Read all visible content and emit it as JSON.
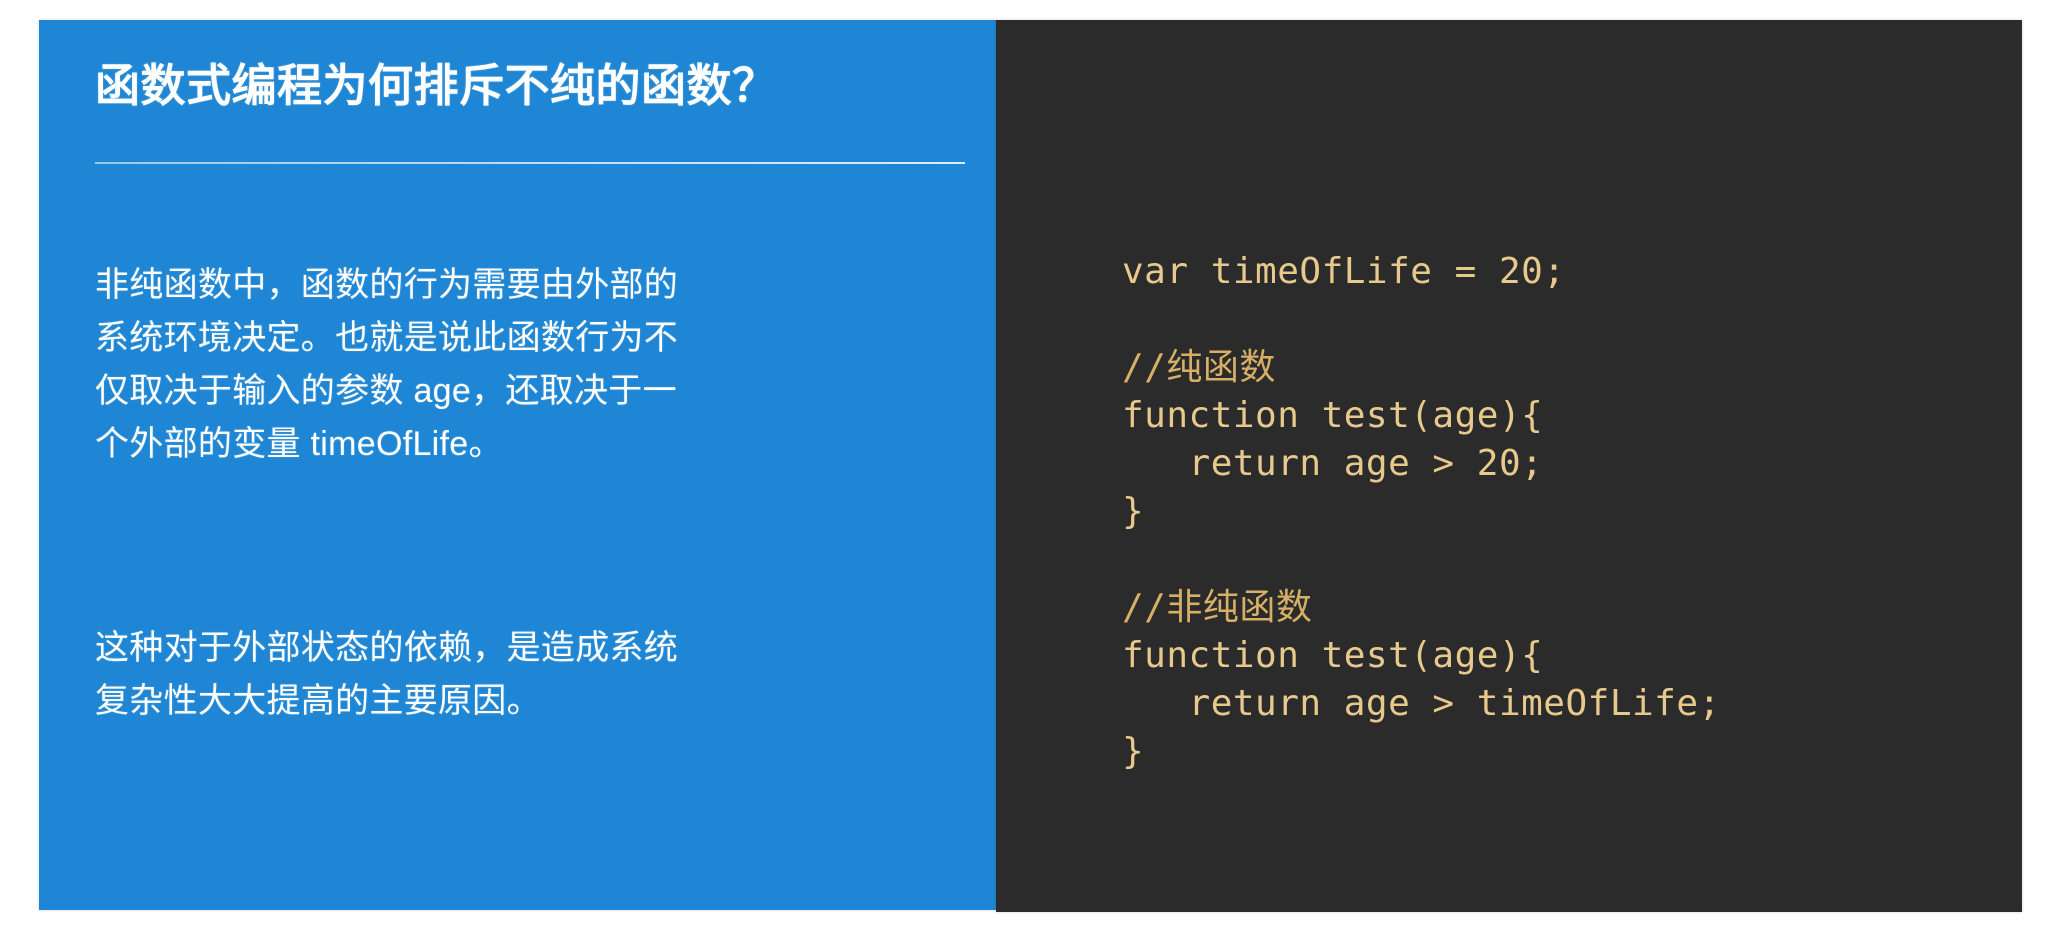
{
  "slide": {
    "background_color": "#ffffff",
    "left_panel": {
      "background_color": "#1e86d4",
      "title": "函数式编程为何排斥不纯的函数？",
      "paragraphs": [
        {
          "lines": [
            "非纯函数中，函数的行为需要由外部的",
            "系统环境决定。也就是说此函数行为不",
            "仅取决于输入的参数 age，还取决于一",
            "个外部的变量 timeOfLife。"
          ]
        },
        {
          "lines": [
            "这种对于外部状态的依赖，是造成系统",
            "复杂性大大提高的主要原因。"
          ]
        }
      ]
    },
    "right_panel": {
      "background_color": "#2b2b2b",
      "code_color": "#e8c98d",
      "comment_color": "#d6b066",
      "language": "javascript",
      "code_lines": [
        {
          "text": "var timeOfLife = 20;",
          "kind": "code"
        },
        {
          "text": "",
          "kind": "blank"
        },
        {
          "text": "//纯函数",
          "kind": "comment"
        },
        {
          "text": "function test(age){",
          "kind": "code"
        },
        {
          "text": "   return age > 20;",
          "kind": "code"
        },
        {
          "text": "}",
          "kind": "code"
        },
        {
          "text": "",
          "kind": "blank"
        },
        {
          "text": "//非纯函数",
          "kind": "comment"
        },
        {
          "text": "function test(age){",
          "kind": "code"
        },
        {
          "text": "   return age > timeOfLife;",
          "kind": "code"
        },
        {
          "text": "}",
          "kind": "code"
        }
      ]
    }
  }
}
